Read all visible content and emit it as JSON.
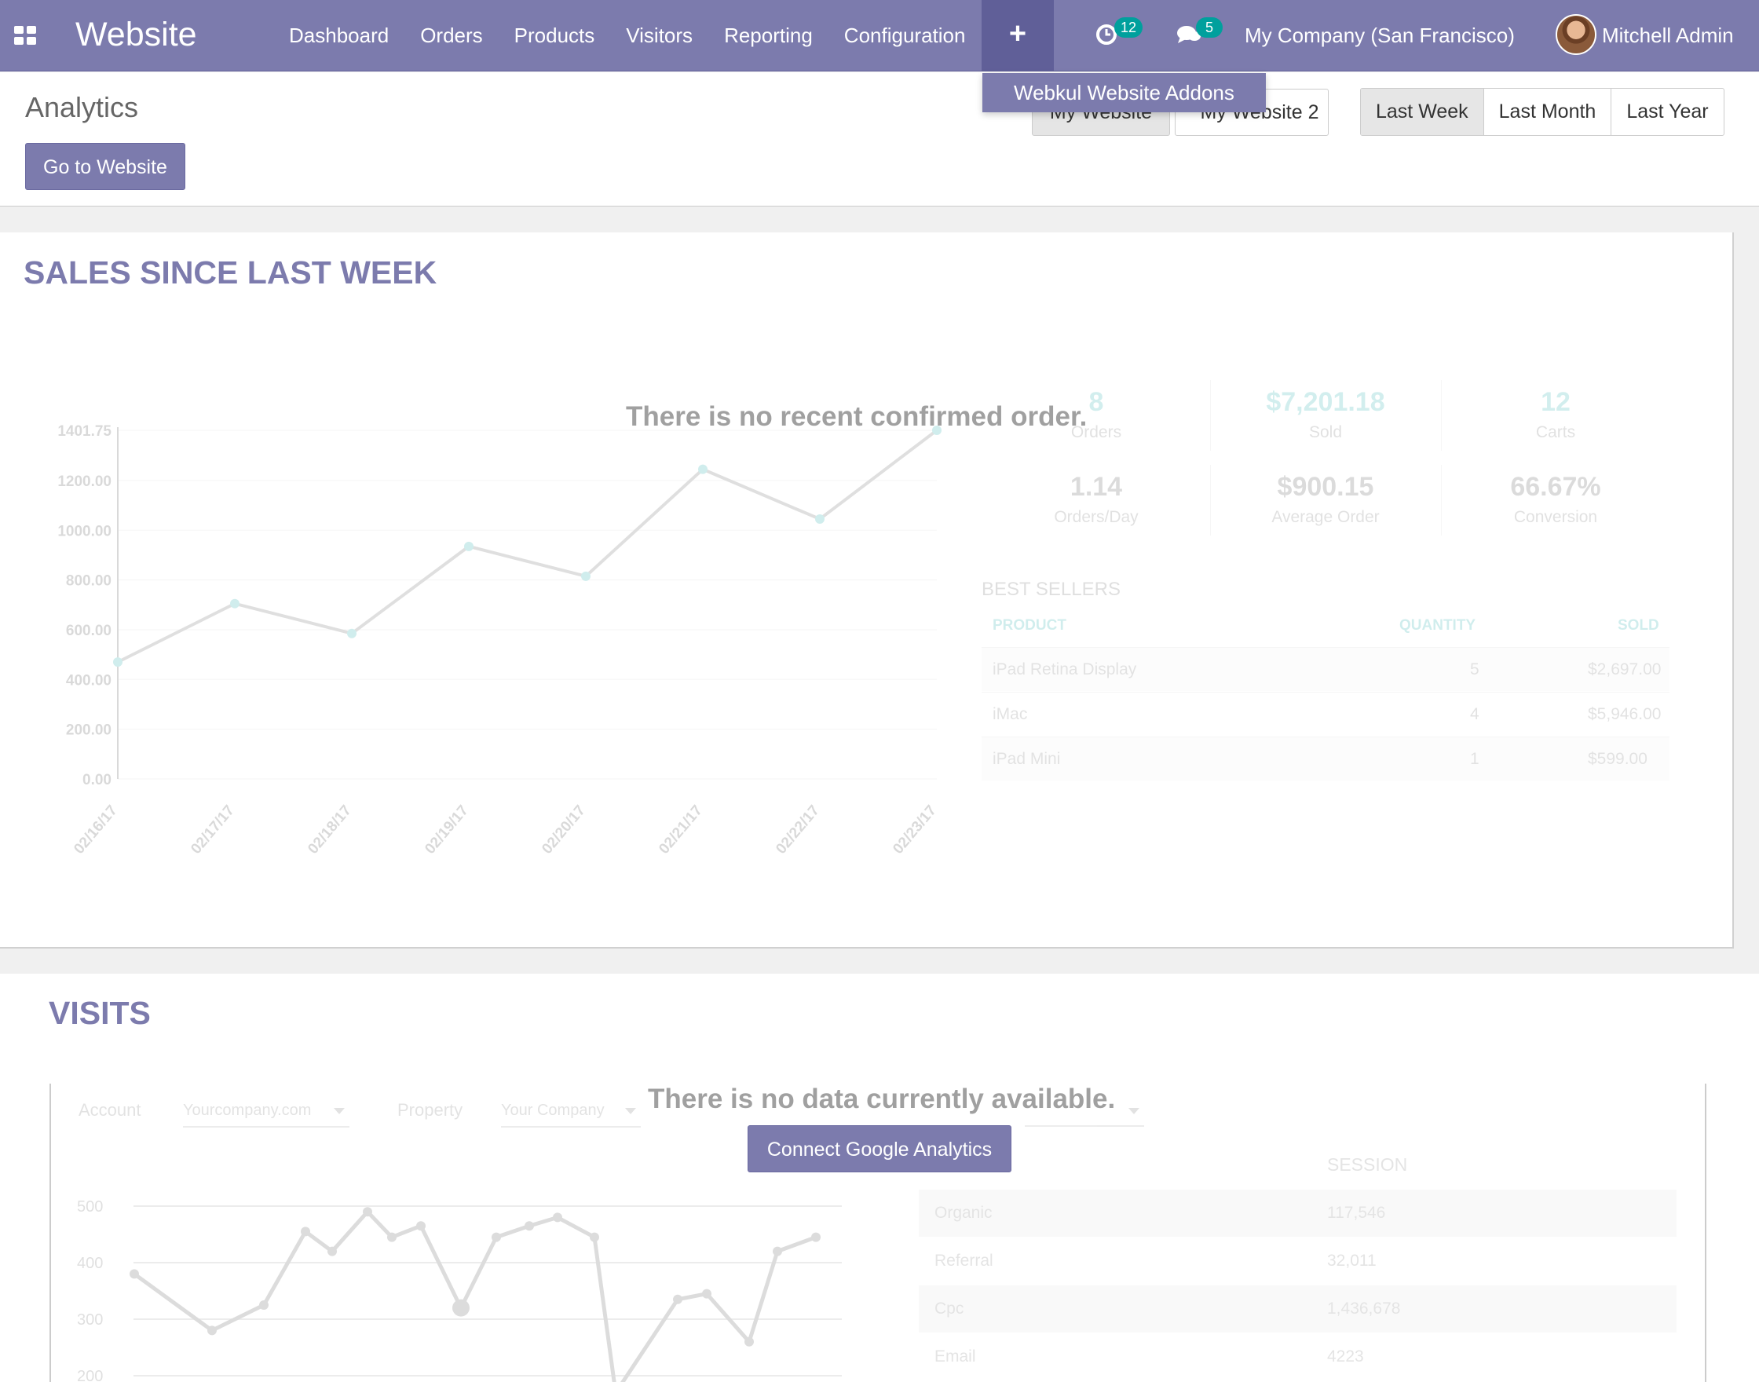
{
  "nav": {
    "brand": "Website",
    "menu": [
      "Dashboard",
      "Orders",
      "Products",
      "Visitors",
      "Reporting",
      "Configuration"
    ],
    "plus_icon": "+",
    "activity_count": "12",
    "messages_count": "5",
    "company": "My Company (San Francisco)",
    "user": "Mitchell Admin",
    "accent": "#7c7bad",
    "badge_color": "#00a09d"
  },
  "dropdown": {
    "label": "Webkul Website Addons"
  },
  "control": {
    "title": "Analytics",
    "go_to_website": "Go to Website",
    "websites": [
      "My Website",
      "My Website 2"
    ],
    "periods": [
      "Last Week",
      "Last Month",
      "Last Year"
    ],
    "active_period": "Last Week"
  },
  "sales": {
    "title": "SALES SINCE LAST WEEK",
    "empty_message": "There is no recent confirmed order.",
    "kpis": [
      {
        "value": "8",
        "label": "Orders"
      },
      {
        "value": "$7,201.18",
        "label": "Sold"
      },
      {
        "value": "12",
        "label": "Carts"
      },
      {
        "value": "1.14",
        "label": "Orders/Day"
      },
      {
        "value": "$900.15",
        "label": "Average Order"
      },
      {
        "value": "66.67%",
        "label": "Conversion"
      }
    ],
    "best_sellers": {
      "title": "BEST SELLERS",
      "headers": [
        "PRODUCT",
        "QUANTITY",
        "SOLD"
      ],
      "rows": [
        [
          "iPad Retina Display",
          "5",
          "$2,697.00"
        ],
        [
          "iMac",
          "4",
          "$5,946.00"
        ],
        [
          "iPad Mini",
          "1",
          "$599.00"
        ]
      ]
    }
  },
  "chart_data": [
    {
      "type": "line",
      "x": [
        "02/16/17",
        "02/17/17",
        "02/18/17",
        "02/19/17",
        "02/20/17",
        "02/21/17",
        "02/22/17",
        "02/23/17"
      ],
      "values": [
        470,
        705,
        585,
        935,
        815,
        1245,
        1045,
        1401.75
      ],
      "y_ticks": [
        "0.00",
        "200.00",
        "400.00",
        "600.00",
        "800.00",
        "1000.00",
        "1200.00",
        "1401.75"
      ],
      "ylim": [
        0,
        1401.75
      ]
    },
    {
      "type": "line",
      "values": [
        380,
        280,
        325,
        455,
        420,
        490,
        445,
        465,
        320,
        445,
        465,
        480,
        445,
        170,
        335,
        345,
        260,
        420,
        445
      ],
      "y_ticks": [
        "200",
        "300",
        "400",
        "500"
      ],
      "ylim": [
        180,
        520
      ]
    }
  ],
  "visits": {
    "title": "VISITS",
    "empty_message": "There is no data currently available.",
    "connect_button": "Connect Google Analytics",
    "account_label": "Account",
    "account_value": "Yourcompany.com",
    "property_label": "Property",
    "property_value": "Your Company",
    "session_header": "SESSION",
    "sources": [
      [
        "Organic",
        "117,546"
      ],
      [
        "Referral",
        "32,011"
      ],
      [
        "Cpc",
        "1,436,678"
      ],
      [
        "Email",
        "4223"
      ]
    ]
  }
}
